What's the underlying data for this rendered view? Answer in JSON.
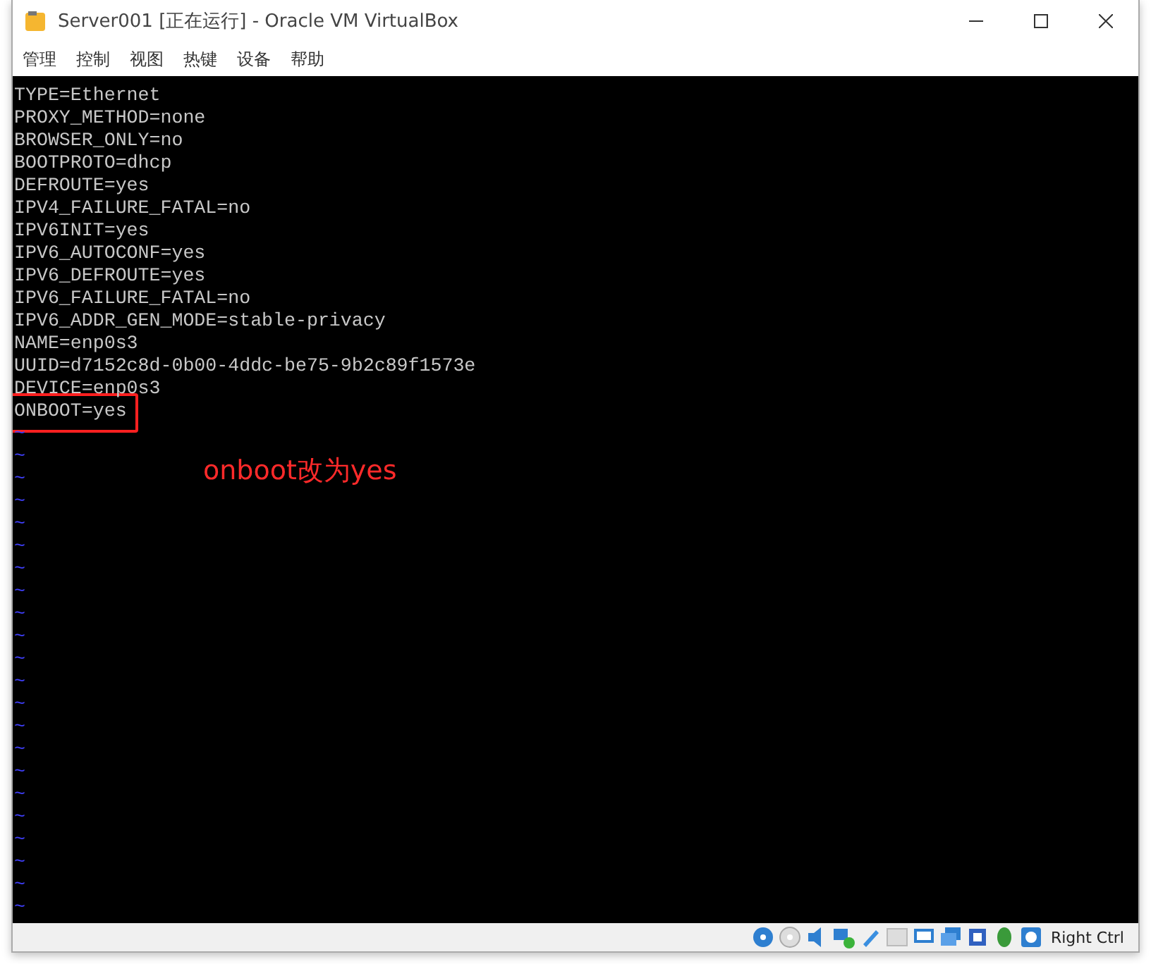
{
  "window": {
    "title": "Server001 [正在运行] - Oracle VM VirtualBox"
  },
  "menu": [
    "管理",
    "控制",
    "视图",
    "热键",
    "设备",
    "帮助"
  ],
  "terminal": {
    "lines": [
      {
        "text": "TYPE=Ethernet",
        "highlighted": false
      },
      {
        "text": "PROXY_METHOD=none",
        "highlighted": false
      },
      {
        "text": "BROWSER_ONLY=no",
        "highlighted": false
      },
      {
        "text": "BOOTPROTO=dhcp",
        "highlighted": false
      },
      {
        "text": "DEFROUTE=yes",
        "highlighted": false
      },
      {
        "text": "IPV4_FAILURE_FATAL=no",
        "highlighted": false
      },
      {
        "text": "IPV6INIT=yes",
        "highlighted": false
      },
      {
        "text": "IPV6_AUTOCONF=yes",
        "highlighted": false
      },
      {
        "text": "IPV6_DEFROUTE=yes",
        "highlighted": false
      },
      {
        "text": "IPV6_FAILURE_FATAL=no",
        "highlighted": false
      },
      {
        "text": "IPV6_ADDR_GEN_MODE=stable-privacy",
        "highlighted": false
      },
      {
        "text": "NAME=enp0s3",
        "highlighted": false
      },
      {
        "text": "UUID=d7152c8d-0b00-4ddc-be75-9b2c89f1573e",
        "highlighted": false
      },
      {
        "text": "DEVICE=enp0s3",
        "highlighted": false
      },
      {
        "text": "ONBOOT=yes",
        "highlighted": true
      }
    ],
    "tildes": [
      "~",
      "~",
      "~",
      "~",
      "~",
      "~",
      "~",
      "~",
      "~",
      "~",
      "~",
      "~",
      "~",
      "~",
      "~",
      "~",
      "~",
      "~",
      "~",
      "~",
      "~",
      "~"
    ],
    "annotation": "onboot改为yes"
  },
  "status_bar": {
    "host_key": "Right Ctrl"
  }
}
